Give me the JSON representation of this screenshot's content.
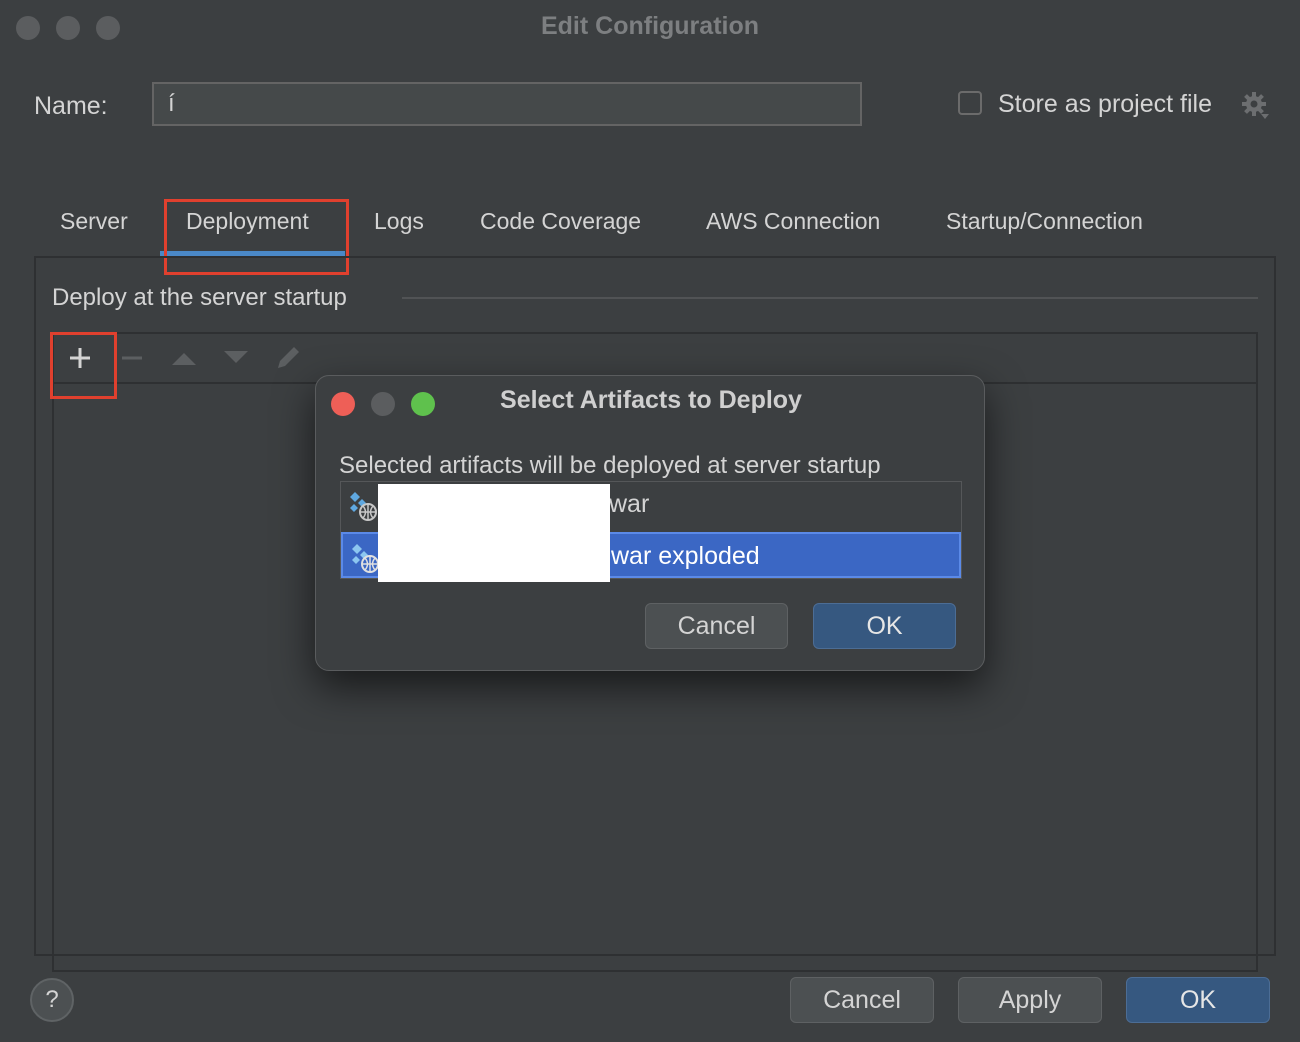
{
  "window": {
    "title": "Edit Configuration"
  },
  "name_field": {
    "label": "Name:",
    "value": "í"
  },
  "store_as_project_file": {
    "label": "Store as project file",
    "checked": false
  },
  "tabs": [
    {
      "label": "Server"
    },
    {
      "label": "Deployment",
      "active": true
    },
    {
      "label": "Logs"
    },
    {
      "label": "Code Coverage"
    },
    {
      "label": "AWS Connection"
    },
    {
      "label": "Startup/Connection"
    }
  ],
  "deployment": {
    "section_title": "Deploy at the server startup",
    "toolbar": [
      "add-icon",
      "remove-icon",
      "move-up-icon",
      "move-down-icon",
      "edit-icon"
    ]
  },
  "footer": {
    "help": "?",
    "cancel": "Cancel",
    "apply": "Apply",
    "ok": "OK"
  },
  "dialog": {
    "title": "Select Artifacts to Deploy",
    "description": "Selected artifacts will be deployed at server startup",
    "artifacts": [
      {
        "label": "war",
        "selected": false
      },
      {
        "label": "war exploded",
        "selected": true
      }
    ],
    "cancel": "Cancel",
    "ok": "OK"
  },
  "colors": {
    "background": "#3c3f41",
    "accent": "#4a88c7",
    "selection": "#3b67c4",
    "primary_button": "#365880",
    "highlight": "#e0402e",
    "traffic_red": "#ee5f57",
    "traffic_green": "#5fc14d"
  }
}
